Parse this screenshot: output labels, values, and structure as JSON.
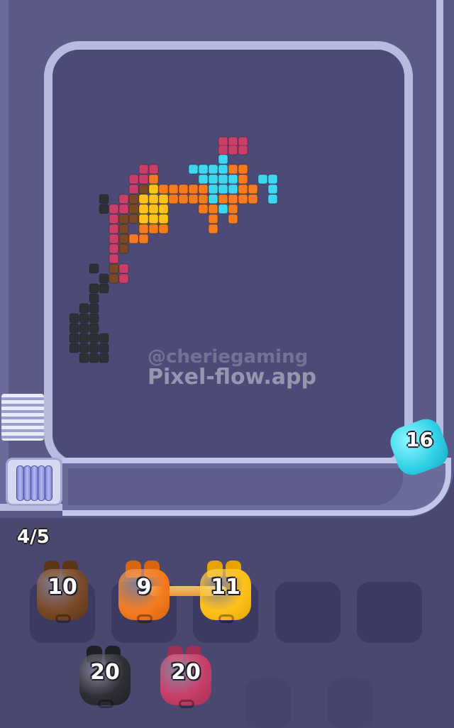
{
  "board": {
    "pixels": [
      {
        "c": "crimson",
        "cells": [
          [
            308,
            193
          ],
          [
            322,
            193
          ],
          [
            336,
            193
          ],
          [
            308,
            205
          ],
          [
            322,
            205
          ],
          [
            336,
            205
          ],
          [
            196,
            232
          ],
          [
            210,
            232
          ],
          [
            182,
            246
          ],
          [
            196,
            246
          ],
          [
            182,
            260
          ],
          [
            168,
            274
          ],
          [
            168,
            288
          ],
          [
            154,
            288
          ],
          [
            154,
            302
          ],
          [
            154,
            316
          ],
          [
            154,
            330
          ],
          [
            154,
            344
          ],
          [
            154,
            358
          ],
          [
            168,
            372
          ],
          [
            168,
            386
          ]
        ]
      },
      {
        "c": "brown",
        "cells": [
          [
            196,
            260
          ],
          [
            182,
            274
          ],
          [
            182,
            288
          ],
          [
            168,
            302
          ],
          [
            182,
            302
          ],
          [
            168,
            316
          ],
          [
            168,
            330
          ],
          [
            168,
            344
          ],
          [
            154,
            372
          ],
          [
            154,
            386
          ]
        ]
      },
      {
        "c": "orange",
        "cells": [
          [
            210,
            246
          ],
          [
            224,
            260
          ],
          [
            238,
            260
          ],
          [
            252,
            260
          ],
          [
            266,
            260
          ],
          [
            280,
            260
          ],
          [
            238,
            274
          ],
          [
            252,
            274
          ],
          [
            266,
            274
          ],
          [
            322,
            232
          ],
          [
            336,
            232
          ],
          [
            336,
            246
          ],
          [
            336,
            260
          ],
          [
            350,
            260
          ],
          [
            280,
            274
          ],
          [
            294,
            274
          ],
          [
            308,
            274
          ],
          [
            322,
            274
          ],
          [
            336,
            274
          ],
          [
            350,
            274
          ],
          [
            280,
            288
          ],
          [
            294,
            288
          ],
          [
            322,
            288
          ],
          [
            294,
            302
          ],
          [
            322,
            302
          ],
          [
            294,
            316
          ],
          [
            196,
            316
          ],
          [
            210,
            316
          ],
          [
            224,
            316
          ],
          [
            182,
            330
          ],
          [
            196,
            330
          ]
        ]
      },
      {
        "c": "gold",
        "cells": [
          [
            210,
            260
          ],
          [
            196,
            274
          ],
          [
            210,
            274
          ],
          [
            224,
            274
          ],
          [
            196,
            288
          ],
          [
            210,
            288
          ],
          [
            224,
            288
          ],
          [
            196,
            302
          ],
          [
            210,
            302
          ],
          [
            224,
            302
          ]
        ]
      },
      {
        "c": "cyan",
        "cells": [
          [
            308,
            218
          ],
          [
            266,
            232
          ],
          [
            280,
            232
          ],
          [
            294,
            232
          ],
          [
            308,
            232
          ],
          [
            280,
            246
          ],
          [
            294,
            246
          ],
          [
            308,
            246
          ],
          [
            322,
            246
          ],
          [
            294,
            260
          ],
          [
            308,
            260
          ],
          [
            322,
            260
          ],
          [
            364,
            246
          ],
          [
            378,
            246
          ],
          [
            378,
            260
          ],
          [
            378,
            274
          ],
          [
            308,
            288
          ],
          [
            294,
            274
          ]
        ]
      },
      {
        "c": "black",
        "cells": [
          [
            140,
            274
          ],
          [
            140,
            288
          ],
          [
            126,
            372
          ],
          [
            140,
            386
          ],
          [
            126,
            400
          ],
          [
            140,
            400
          ],
          [
            126,
            414
          ],
          [
            112,
            428
          ],
          [
            126,
            428
          ],
          [
            98,
            442
          ],
          [
            112,
            442
          ],
          [
            126,
            442
          ],
          [
            98,
            456
          ],
          [
            112,
            456
          ],
          [
            126,
            456
          ],
          [
            98,
            470
          ],
          [
            112,
            470
          ],
          [
            126,
            470
          ],
          [
            140,
            470
          ],
          [
            98,
            484
          ],
          [
            112,
            484
          ],
          [
            126,
            484
          ],
          [
            140,
            484
          ],
          [
            112,
            498
          ],
          [
            126,
            498
          ],
          [
            140,
            498
          ]
        ]
      }
    ],
    "colors": {
      "crimson": "#c93f6a",
      "brown": "#7a4a28",
      "orange": "#f47b1f",
      "gold": "#ffc21a",
      "cyan": "#3fd6f0",
      "black": "#2f3036"
    }
  },
  "watermark": {
    "handle": "@cheriegaming",
    "site": "Pixel-flow.app"
  },
  "queue": {
    "counter": "4/5",
    "spools": 5
  },
  "shooter": {
    "number": "16",
    "color": "#2fd0e6"
  },
  "slots_row1": [
    {
      "number": "10",
      "color": "#7a4a28",
      "ear": "#5c3518"
    },
    {
      "number": "9",
      "color": "#f47b1f",
      "ear": "#d9650f"
    },
    {
      "number": "11",
      "color": "#ffc21a",
      "ear": "#e6a400"
    },
    {
      "number": "",
      "color": "",
      "ear": ""
    },
    {
      "number": "",
      "color": "",
      "ear": ""
    }
  ],
  "slots_row2": [
    {
      "number": "20",
      "color": "#2f3036",
      "ear": "#1f2026"
    },
    {
      "number": "20",
      "color": "#c93f6a",
      "ear": "#a12f54"
    }
  ]
}
